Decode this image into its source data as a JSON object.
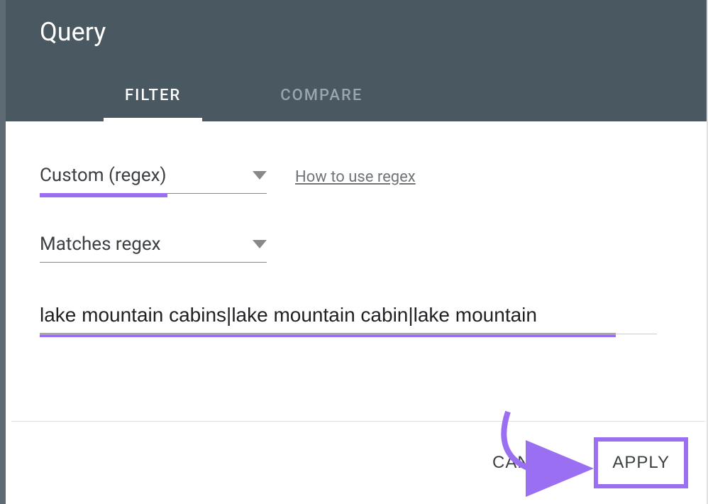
{
  "header": {
    "title": "Query"
  },
  "tabs": {
    "filter": "FILTER",
    "compare": "COMPARE"
  },
  "filter": {
    "type_select": "Custom (regex)",
    "help_link": "How to use regex",
    "match_select": "Matches regex",
    "regex_value": "lake mountain cabins|lake mountain cabin|lake mountain"
  },
  "footer": {
    "cancel": "CANCEL",
    "apply": "APPLY"
  }
}
